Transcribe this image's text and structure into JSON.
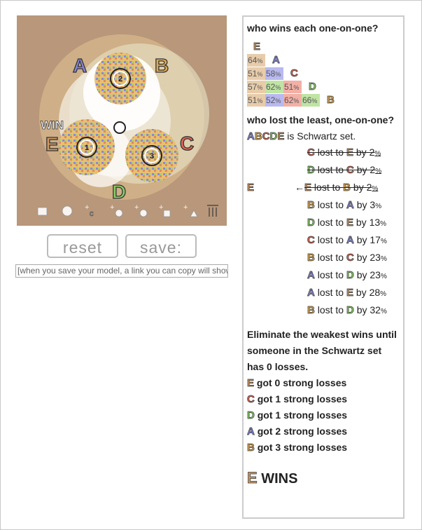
{
  "canvas": {
    "candidates": [
      {
        "letter": "A",
        "color": "#8888dd"
      },
      {
        "letter": "B",
        "color": "#ddaa55"
      },
      {
        "letter": "C",
        "color": "#dd6655"
      },
      {
        "letter": "D",
        "color": "#88cc66"
      },
      {
        "letter": "E",
        "color": "#cc9966"
      }
    ],
    "voter_groups": [
      "2",
      "1",
      "3"
    ],
    "win_label": "WIN",
    "toolbar_icons": [
      "dropdown-icon",
      "gear-icon",
      "add-candidate-icon",
      "add-voter-icon",
      "add-voter-group-icon",
      "add-grid-icon",
      "add-triangle-icon",
      "trash-icon"
    ],
    "toolbar_c_label": "c"
  },
  "buttons": {
    "reset_label": "reset",
    "save_label": "save:"
  },
  "save_hint": "[when you save your model, a link you can copy will show up here]",
  "panel": {
    "heading1": "who wins each one-on-one?",
    "matrix": {
      "col_letters": [
        "E",
        "A",
        "C",
        "D",
        "B"
      ],
      "rows": [
        {
          "cells": [
            {
              "c": "E",
              "v": "64"
            }
          ]
        },
        {
          "cells": [
            {
              "c": "E",
              "v": "51"
            },
            {
              "c": "A",
              "v": "58"
            }
          ]
        },
        {
          "cells": [
            {
              "c": "E",
              "v": "57"
            },
            {
              "c": "D",
              "v": "62"
            },
            {
              "c": "C",
              "v": "51"
            }
          ]
        },
        {
          "cells": [
            {
              "c": "E",
              "v": "51"
            },
            {
              "c": "A",
              "v": "52"
            },
            {
              "c": "C",
              "v": "62"
            },
            {
              "c": "D",
              "v": "66"
            }
          ]
        }
      ],
      "pct": "%"
    },
    "heading2": "who lost the least, one-on-one?",
    "schwartz_letters": [
      "A",
      "B",
      "C",
      "D",
      "E"
    ],
    "schwartz_text": "is Schwartz set.",
    "losses": [
      {
        "loser": "C",
        "winner": "E",
        "margin": "2",
        "struck": true
      },
      {
        "loser": "D",
        "winner": "C",
        "margin": "2",
        "struck": true
      },
      {
        "loser": "E",
        "winner": "B",
        "margin": "2",
        "struck": true,
        "left": "E",
        "arrow": "←"
      },
      {
        "loser": "B",
        "winner": "A",
        "margin": "3",
        "struck": false
      },
      {
        "loser": "D",
        "winner": "E",
        "margin": "13",
        "struck": false
      },
      {
        "loser": "C",
        "winner": "A",
        "margin": "17",
        "struck": false
      },
      {
        "loser": "B",
        "winner": "C",
        "margin": "23",
        "struck": false
      },
      {
        "loser": "A",
        "winner": "D",
        "margin": "23",
        "struck": false
      },
      {
        "loser": "A",
        "winner": "E",
        "margin": "28",
        "struck": false
      },
      {
        "loser": "B",
        "winner": "D",
        "margin": "32",
        "struck": false
      }
    ],
    "lost_to_word": "lost to",
    "by_word": "by",
    "heading3": "Eliminate the weakest wins until someone in the Schwartz set has 0 losses.",
    "strong": [
      {
        "c": "E",
        "text": "got 0 strong losses"
      },
      {
        "c": "C",
        "text": "got 1 strong losses"
      },
      {
        "c": "D",
        "text": "got 1 strong losses"
      },
      {
        "c": "A",
        "text": "got 2 strong losses"
      },
      {
        "c": "B",
        "text": "got 3 strong losses"
      }
    ],
    "winner": "E",
    "wins_text": "WINS"
  }
}
